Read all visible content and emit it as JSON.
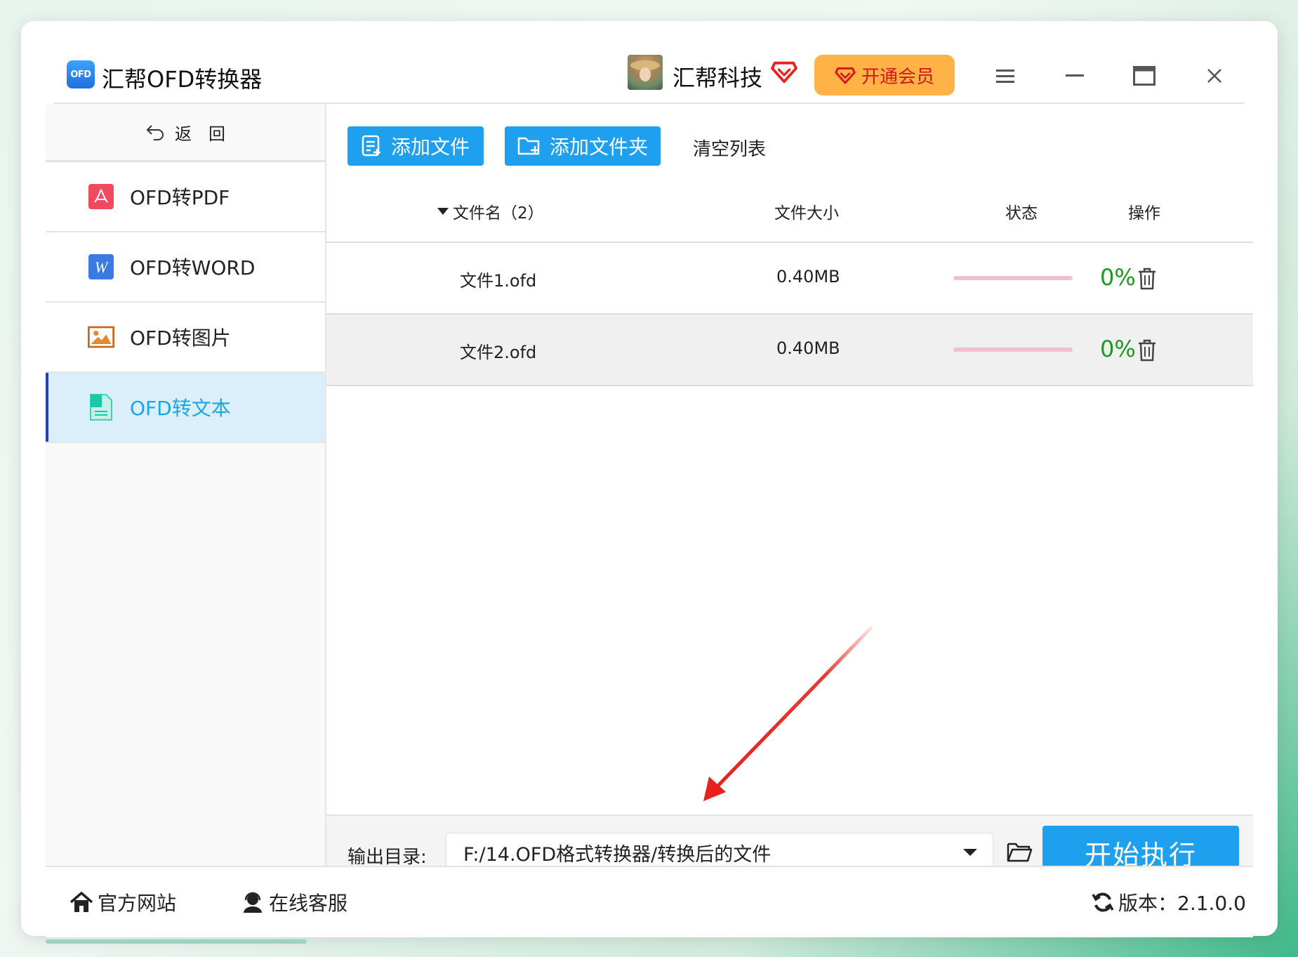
{
  "header": {
    "logo_text": "OFD",
    "app_title": "汇帮OFD转换器",
    "company": "汇帮科技",
    "vip_button": "开通会员",
    "icons": [
      "menu-icon",
      "minimize-icon",
      "maximize-icon",
      "close-icon"
    ]
  },
  "sidebar": {
    "back_icon": "back-arrow-icon",
    "back_label": "返　回",
    "items": [
      {
        "label": "OFD转PDF",
        "icon": "pdf-icon"
      },
      {
        "label": "OFD转WORD",
        "icon": "word-icon"
      },
      {
        "label": "OFD转图片",
        "icon": "image-icon"
      },
      {
        "label": "OFD转文本",
        "icon": "text-doc-icon",
        "active": true
      }
    ]
  },
  "toolbar": {
    "add_file": "添加文件",
    "add_folder": "添加文件夹",
    "clear_list": "清空列表"
  },
  "table": {
    "headers": {
      "name": "文件名（2）",
      "size": "文件大小",
      "status": "状态",
      "action": "操作"
    },
    "rows": [
      {
        "name": "文件1.ofd",
        "size": "0.40MB",
        "progress": 0,
        "percent": "0%"
      },
      {
        "name": "文件2.ofd",
        "size": "0.40MB",
        "progress": 0,
        "percent": "0%"
      }
    ]
  },
  "output": {
    "label": "输出目录:",
    "path": "F:/14.OFD格式转换器/转换后的文件",
    "start_button": "开始执行"
  },
  "footer": {
    "website": "官方网站",
    "support": "在线客服",
    "version": "版本：2.1.0.0"
  },
  "colors": {
    "accent": "#1ea0ef",
    "vip": "#ffb347",
    "vip_text": "#d8141e",
    "active_bg": "#daeffa",
    "active_text": "#1aa6e6",
    "percent": "#1a9a1a",
    "annotation_arrow": "#e8211d"
  }
}
